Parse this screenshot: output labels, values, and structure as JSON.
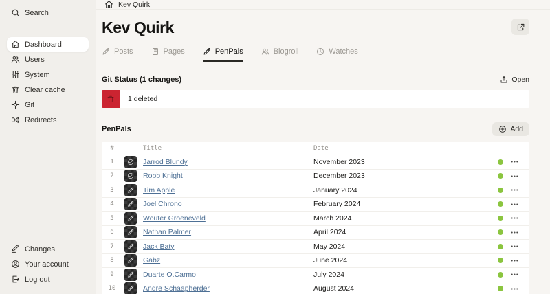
{
  "sidebar": {
    "search": {
      "label": "Search",
      "icon": "search"
    },
    "items": [
      {
        "label": "Dashboard",
        "icon": "home",
        "active": true
      },
      {
        "label": "Users",
        "icon": "users",
        "active": false
      },
      {
        "label": "System",
        "icon": "sliders",
        "active": false
      },
      {
        "label": "Clear cache",
        "icon": "trash",
        "active": false
      },
      {
        "label": "Git",
        "icon": "git",
        "active": false
      },
      {
        "label": "Redirects",
        "icon": "shuffle",
        "active": false
      }
    ],
    "footer_items": [
      {
        "label": "Changes",
        "icon": "pencil-line"
      },
      {
        "label": "Your account",
        "icon": "user-circle"
      },
      {
        "label": "Log out",
        "icon": "logout"
      }
    ]
  },
  "header": {
    "breadcrumb": "Kev Quirk",
    "title": "Kev Quirk"
  },
  "tabs": [
    {
      "label": "Posts",
      "icon": "pencil",
      "active": false
    },
    {
      "label": "Pages",
      "icon": "book",
      "active": false
    },
    {
      "label": "PenPals",
      "icon": "pencil",
      "active": true
    },
    {
      "label": "Blogroll",
      "icon": "users",
      "active": false
    },
    {
      "label": "Watches",
      "icon": "clock",
      "active": false
    }
  ],
  "git_status": {
    "title": "Git Status (1 changes)",
    "open_label": "Open",
    "change_label": "1 deleted"
  },
  "collection": {
    "title": "PenPals",
    "add_label": "Add",
    "columns": {
      "num": "#",
      "title": "Title",
      "date": "Date"
    },
    "rows": [
      {
        "num": "1",
        "title": "Jarrod Blundy",
        "date": "November 2023",
        "icon": "check-circle",
        "status": "published"
      },
      {
        "num": "2",
        "title": "Robb Knight",
        "date": "December 2023",
        "icon": "check-circle",
        "status": "published"
      },
      {
        "num": "3",
        "title": "Tim Apple",
        "date": "January 2024",
        "icon": "pencil",
        "status": "published"
      },
      {
        "num": "4",
        "title": "Joel Chrono",
        "date": "February 2024",
        "icon": "pencil",
        "status": "published"
      },
      {
        "num": "5",
        "title": "Wouter Groeneveld",
        "date": "March 2024",
        "icon": "pencil",
        "status": "published"
      },
      {
        "num": "6",
        "title": "Nathan Palmer",
        "date": "April 2024",
        "icon": "pencil",
        "status": "published"
      },
      {
        "num": "7",
        "title": "Jack Baty",
        "date": "May 2024",
        "icon": "pencil",
        "status": "published"
      },
      {
        "num": "8",
        "title": "Gabz",
        "date": "June 2024",
        "icon": "pencil",
        "status": "published"
      },
      {
        "num": "9",
        "title": "Duarte O.Carmo",
        "date": "July 2024",
        "icon": "pencil",
        "status": "published"
      },
      {
        "num": "10",
        "title": "Andre Schaapherder",
        "date": "August 2024",
        "icon": "pencil",
        "status": "published"
      }
    ]
  },
  "colors": {
    "deleted_red": "#cb2431",
    "status_green": "#8bc53f",
    "link_blue": "#4e7095",
    "sidebar_bg": "#f1efeb",
    "main_bg": "#f7f5f2"
  }
}
